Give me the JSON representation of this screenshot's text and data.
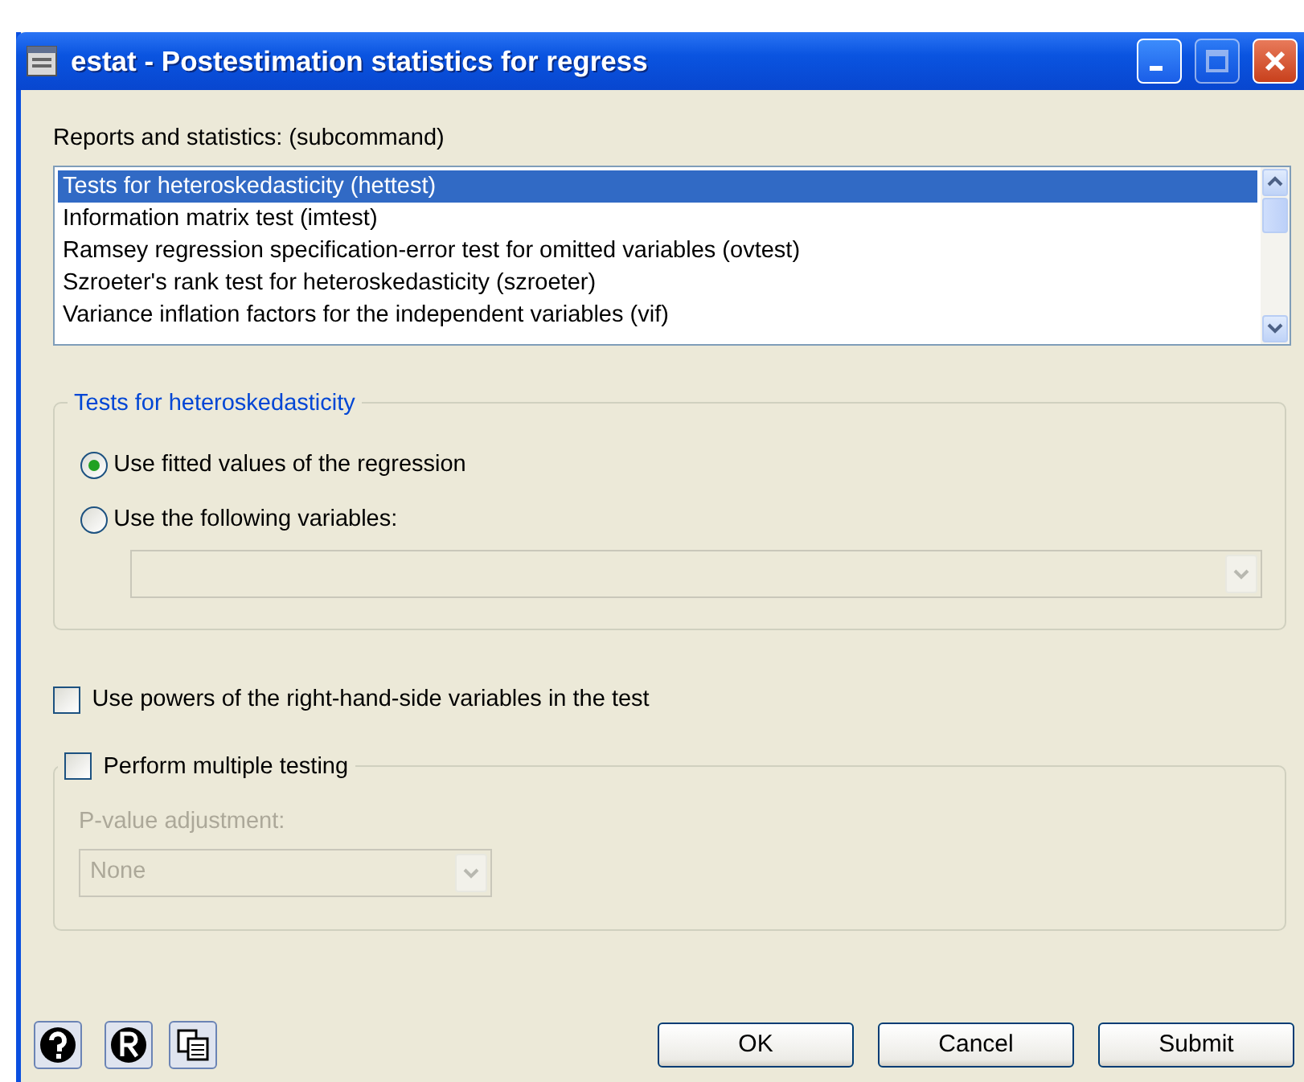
{
  "window": {
    "title": "estat - Postestimation statistics for regress"
  },
  "reports": {
    "label": "Reports and statistics: (subcommand)",
    "items": [
      {
        "label": "Tests for heteroskedasticity (hettest)",
        "selected": true
      },
      {
        "label": "Information matrix test (imtest)",
        "selected": false
      },
      {
        "label": "Ramsey regression specification-error test for omitted variables (ovtest)",
        "selected": false
      },
      {
        "label": "Szroeter's rank test for heteroskedasticity (szroeter)",
        "selected": false
      },
      {
        "label": "Variance inflation factors for the independent variables (vif)",
        "selected": false
      }
    ]
  },
  "hettest_group": {
    "title": "Tests for heteroskedasticity",
    "options": [
      {
        "label": "Use fitted values of the regression",
        "selected": true
      },
      {
        "label": "Use the following variables:",
        "selected": false
      }
    ],
    "variables_combo": {
      "disabled": true
    }
  },
  "powers_checkbox": {
    "label": "Use powers of the right-hand-side variables in the test",
    "checked": false
  },
  "multiple_testing": {
    "label": "Perform multiple testing",
    "checked": false,
    "adjustment_label": "P-value adjustment:",
    "adjustment_value": "None",
    "disabled": true
  },
  "buttons": [
    {
      "label": "OK"
    },
    {
      "label": "Cancel"
    },
    {
      "label": "Submit"
    }
  ]
}
